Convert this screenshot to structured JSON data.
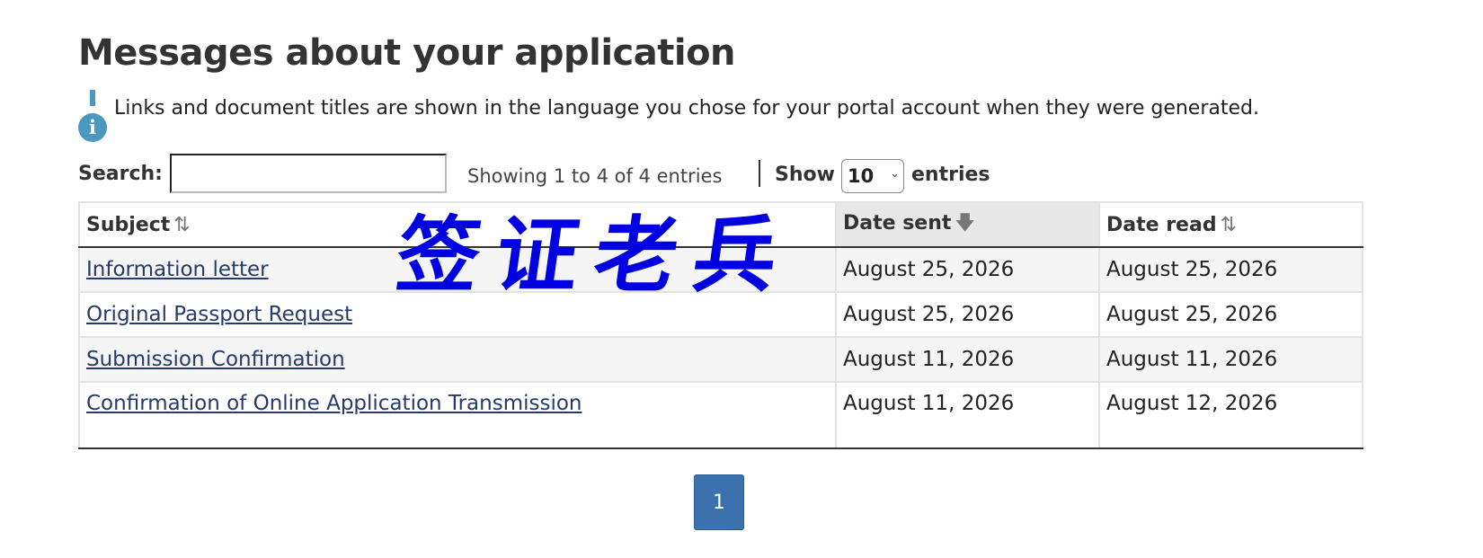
{
  "page": {
    "title": "Messages about your application",
    "notice": "Links and document titles are shown in the language you chose for your portal account when they were generated."
  },
  "icons": {
    "info": "info-icon",
    "sort_both": "sort-both-icon",
    "sort_desc": "sort-desc-icon"
  },
  "colors": {
    "info_icon": "#4a98bf",
    "link": "#243b6b",
    "pagination_active": "#3b72ae",
    "watermark": "#0000e0"
  },
  "toolbar": {
    "search_label": "Search:",
    "search_value": "",
    "info": "Showing 1 to 4 of 4 entries",
    "show_label": "Show",
    "page_length": "10",
    "entries_label": "entries"
  },
  "table": {
    "columns": [
      {
        "label": "Subject",
        "sort_icon": "⇅"
      },
      {
        "label": "Date sent",
        "sort_icon": "🡇"
      },
      {
        "label": "Date read",
        "sort_icon": "⇅"
      }
    ],
    "rows": [
      {
        "subject": "Information letter",
        "date_sent": "August 25, 2026",
        "date_read": "August 25, 2026"
      },
      {
        "subject": "Original Passport Request",
        "date_sent": "August 25, 2026",
        "date_read": "August 25, 2026"
      },
      {
        "subject": "Submission Confirmation",
        "date_sent": "August 11, 2026",
        "date_read": "August 11, 2026"
      },
      {
        "subject": "Confirmation of Online Application Transmission",
        "date_sent": "August 11, 2026",
        "date_read": "August 12, 2026"
      }
    ]
  },
  "watermark": "签证老兵",
  "pagination": {
    "current": "1"
  }
}
